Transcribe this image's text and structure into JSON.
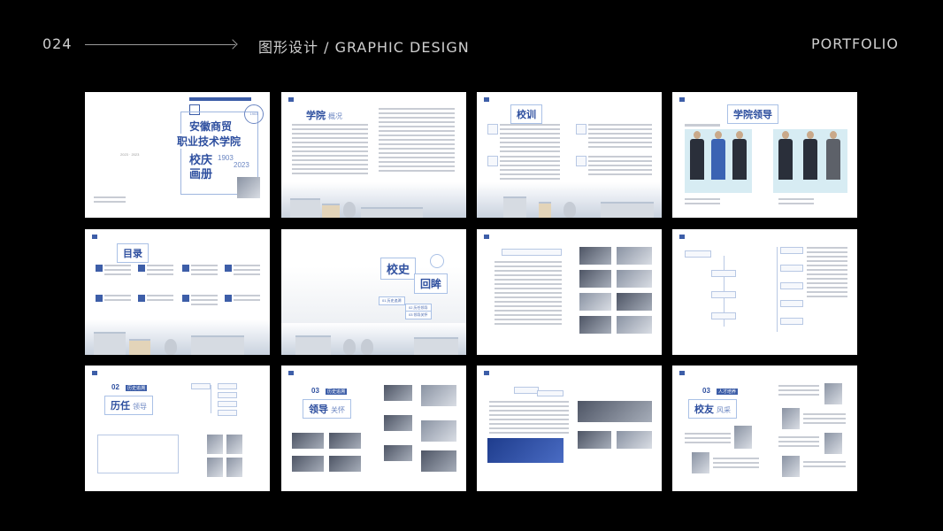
{
  "header": {
    "page_number": "024",
    "category": "图形设计 / GRAPHIC DESIGN",
    "portfolio": "PORTFOLIO"
  },
  "pages": {
    "cover": {
      "name_line1": "安徽商贸",
      "name_line2": "职业技术学院",
      "brochure_line1": "校庆",
      "brochure_line2": "画册",
      "year_start": "1903",
      "year_end": "2023",
      "year_range": "2023 · 2023",
      "seal_text": "1903"
    },
    "college": {
      "title": "学院",
      "subtitle": "概况"
    },
    "motto": {
      "title": "校训"
    },
    "leadership": {
      "title": "学院领导"
    },
    "contents": {
      "title": "目录"
    },
    "history": {
      "title_a": "校史",
      "title_b": "回眸",
      "items": [
        "01 历史追溯",
        "02 历任领导",
        "03 领导关怀"
      ]
    },
    "former_leaders": {
      "number": "02",
      "small": "历史追溯",
      "title": "历任",
      "title2": "领导"
    },
    "leaders_care": {
      "number": "03",
      "small": "历史追溯",
      "title": "领导",
      "title2": "关怀"
    },
    "alumni": {
      "number": "03",
      "small": "人才培养",
      "title": "校友",
      "title2": "风采"
    }
  }
}
